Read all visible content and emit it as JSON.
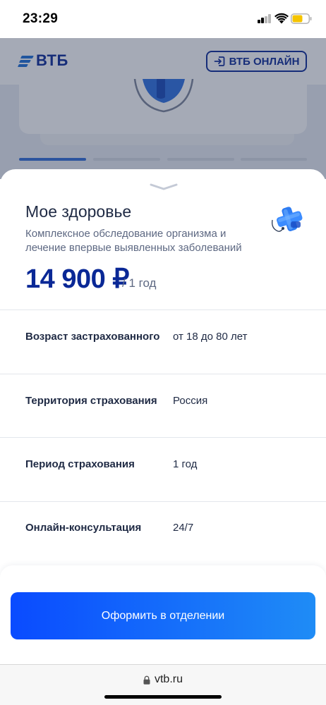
{
  "status_bar": {
    "time": "23:29",
    "signal_bars_active": 2,
    "battery_color": "#f5c400"
  },
  "background_page": {
    "logo_text": "ВТБ",
    "online_button_label": "ВТБ ОНЛАЙН",
    "pager_active_index": 0,
    "pager_count": 4
  },
  "sheet": {
    "title": "Мое здоровье",
    "subtitle": "Комплексное обследование организма и лечение впервые выявленных заболеваний",
    "price": "14 900 ₽",
    "period": "/ 1 год",
    "icon": "medical-cross-3d-icon",
    "rows": [
      {
        "label": "Возраст застрахованного",
        "value": "от 18 до 80 лет"
      },
      {
        "label": "Территория страхования",
        "value": "Россия"
      },
      {
        "label": "Период страхования",
        "value": "1 год"
      },
      {
        "label": "Онлайн-консультация",
        "value": "24/7"
      }
    ],
    "cta_label": "Оформить в отделении"
  },
  "browser": {
    "url": "vtb.ru"
  },
  "colors": {
    "brand_blue": "#0a2896",
    "cta_gradient_start": "#0a4bff",
    "cta_gradient_end": "#1f8cf6",
    "text_primary": "#1f2a44",
    "text_secondary": "#5d6882"
  }
}
